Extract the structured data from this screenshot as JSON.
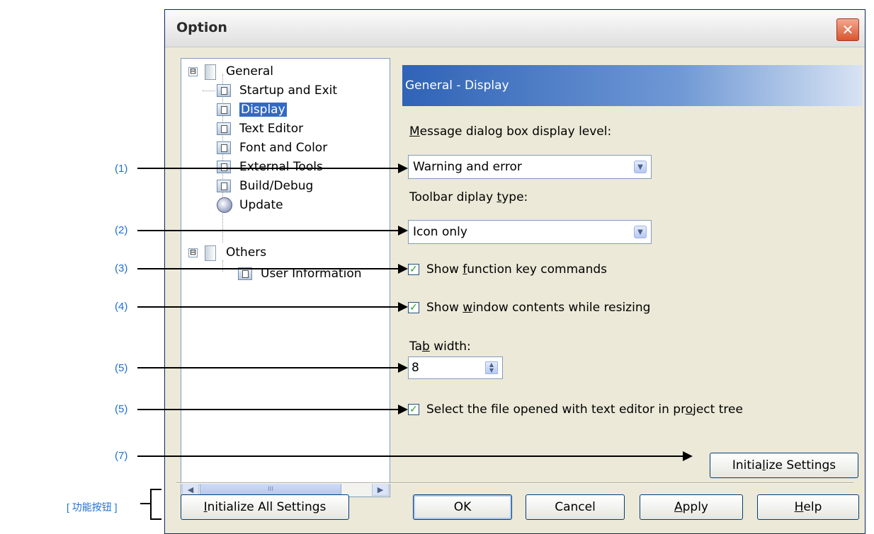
{
  "window": {
    "title": "Option"
  },
  "tree": {
    "items": [
      {
        "label": "General",
        "level": 0,
        "expander": "⊟",
        "icon": "folder-icon"
      },
      {
        "label": "Startup and Exit",
        "level": 1,
        "icon": "page-icon"
      },
      {
        "label": "Display",
        "level": 1,
        "icon": "page-icon",
        "selected": true
      },
      {
        "label": "Text Editor",
        "level": 1,
        "icon": "page-icon"
      },
      {
        "label": "Font and Color",
        "level": 1,
        "icon": "page-icon"
      },
      {
        "label": "External Tools",
        "level": 1,
        "icon": "page-icon"
      },
      {
        "label": "Build/Debug",
        "level": 1,
        "icon": "page-icon"
      },
      {
        "label": "Update",
        "level": 1,
        "icon": "update-icon"
      },
      {
        "label": "Others",
        "level": 0,
        "expander": "⊟",
        "icon": "folder-icon"
      },
      {
        "label": "User Information",
        "level": 1,
        "icon": "page-icon"
      }
    ]
  },
  "panel": {
    "header": "General - Display",
    "message_level": {
      "label_u": "M",
      "label_rest": "essage dialog box display level:",
      "value": "Warning and error"
    },
    "toolbar_type": {
      "label_a": "Toolbar diplay ",
      "label_u": "t",
      "label_b": "ype:",
      "value": "Icon only"
    },
    "show_fkeys": {
      "checked": true,
      "label_a": "Show ",
      "label_u": "f",
      "label_b": "unction key commands"
    },
    "show_window": {
      "checked": true,
      "label_a": "Show ",
      "label_u": "w",
      "label_b": "indow contents while resizing"
    },
    "tab_width": {
      "label_a": "Ta",
      "label_u": "b",
      "label_b": " width:",
      "value": "8"
    },
    "select_file": {
      "checked": true,
      "label_a": "Select the file opened with text editor in pr",
      "label_u": "o",
      "label_b": "ject tree"
    },
    "init_settings": {
      "label_a": "Initia",
      "label_u": "l",
      "label_b": "ize Settings"
    }
  },
  "footer": {
    "init_all": {
      "label_u": "I",
      "label_rest": "nitialize All Settings"
    },
    "ok": "OK",
    "cancel": "Cancel",
    "apply": {
      "label_u": "A",
      "label_rest": "pply"
    },
    "help": {
      "label_u": "H",
      "label_rest": "elp"
    }
  },
  "annotations": {
    "labels": [
      "(1)",
      "(2)",
      "(3)",
      "(4)",
      "(5)",
      "(5)",
      "(7)"
    ],
    "footer_label": "[ 功能按钮 ]"
  },
  "colors": {
    "annotation": "#1f6fd1",
    "selection": "#316ac5",
    "header_gradient_start": "#2f63b6",
    "checkmark": "#21a121"
  }
}
